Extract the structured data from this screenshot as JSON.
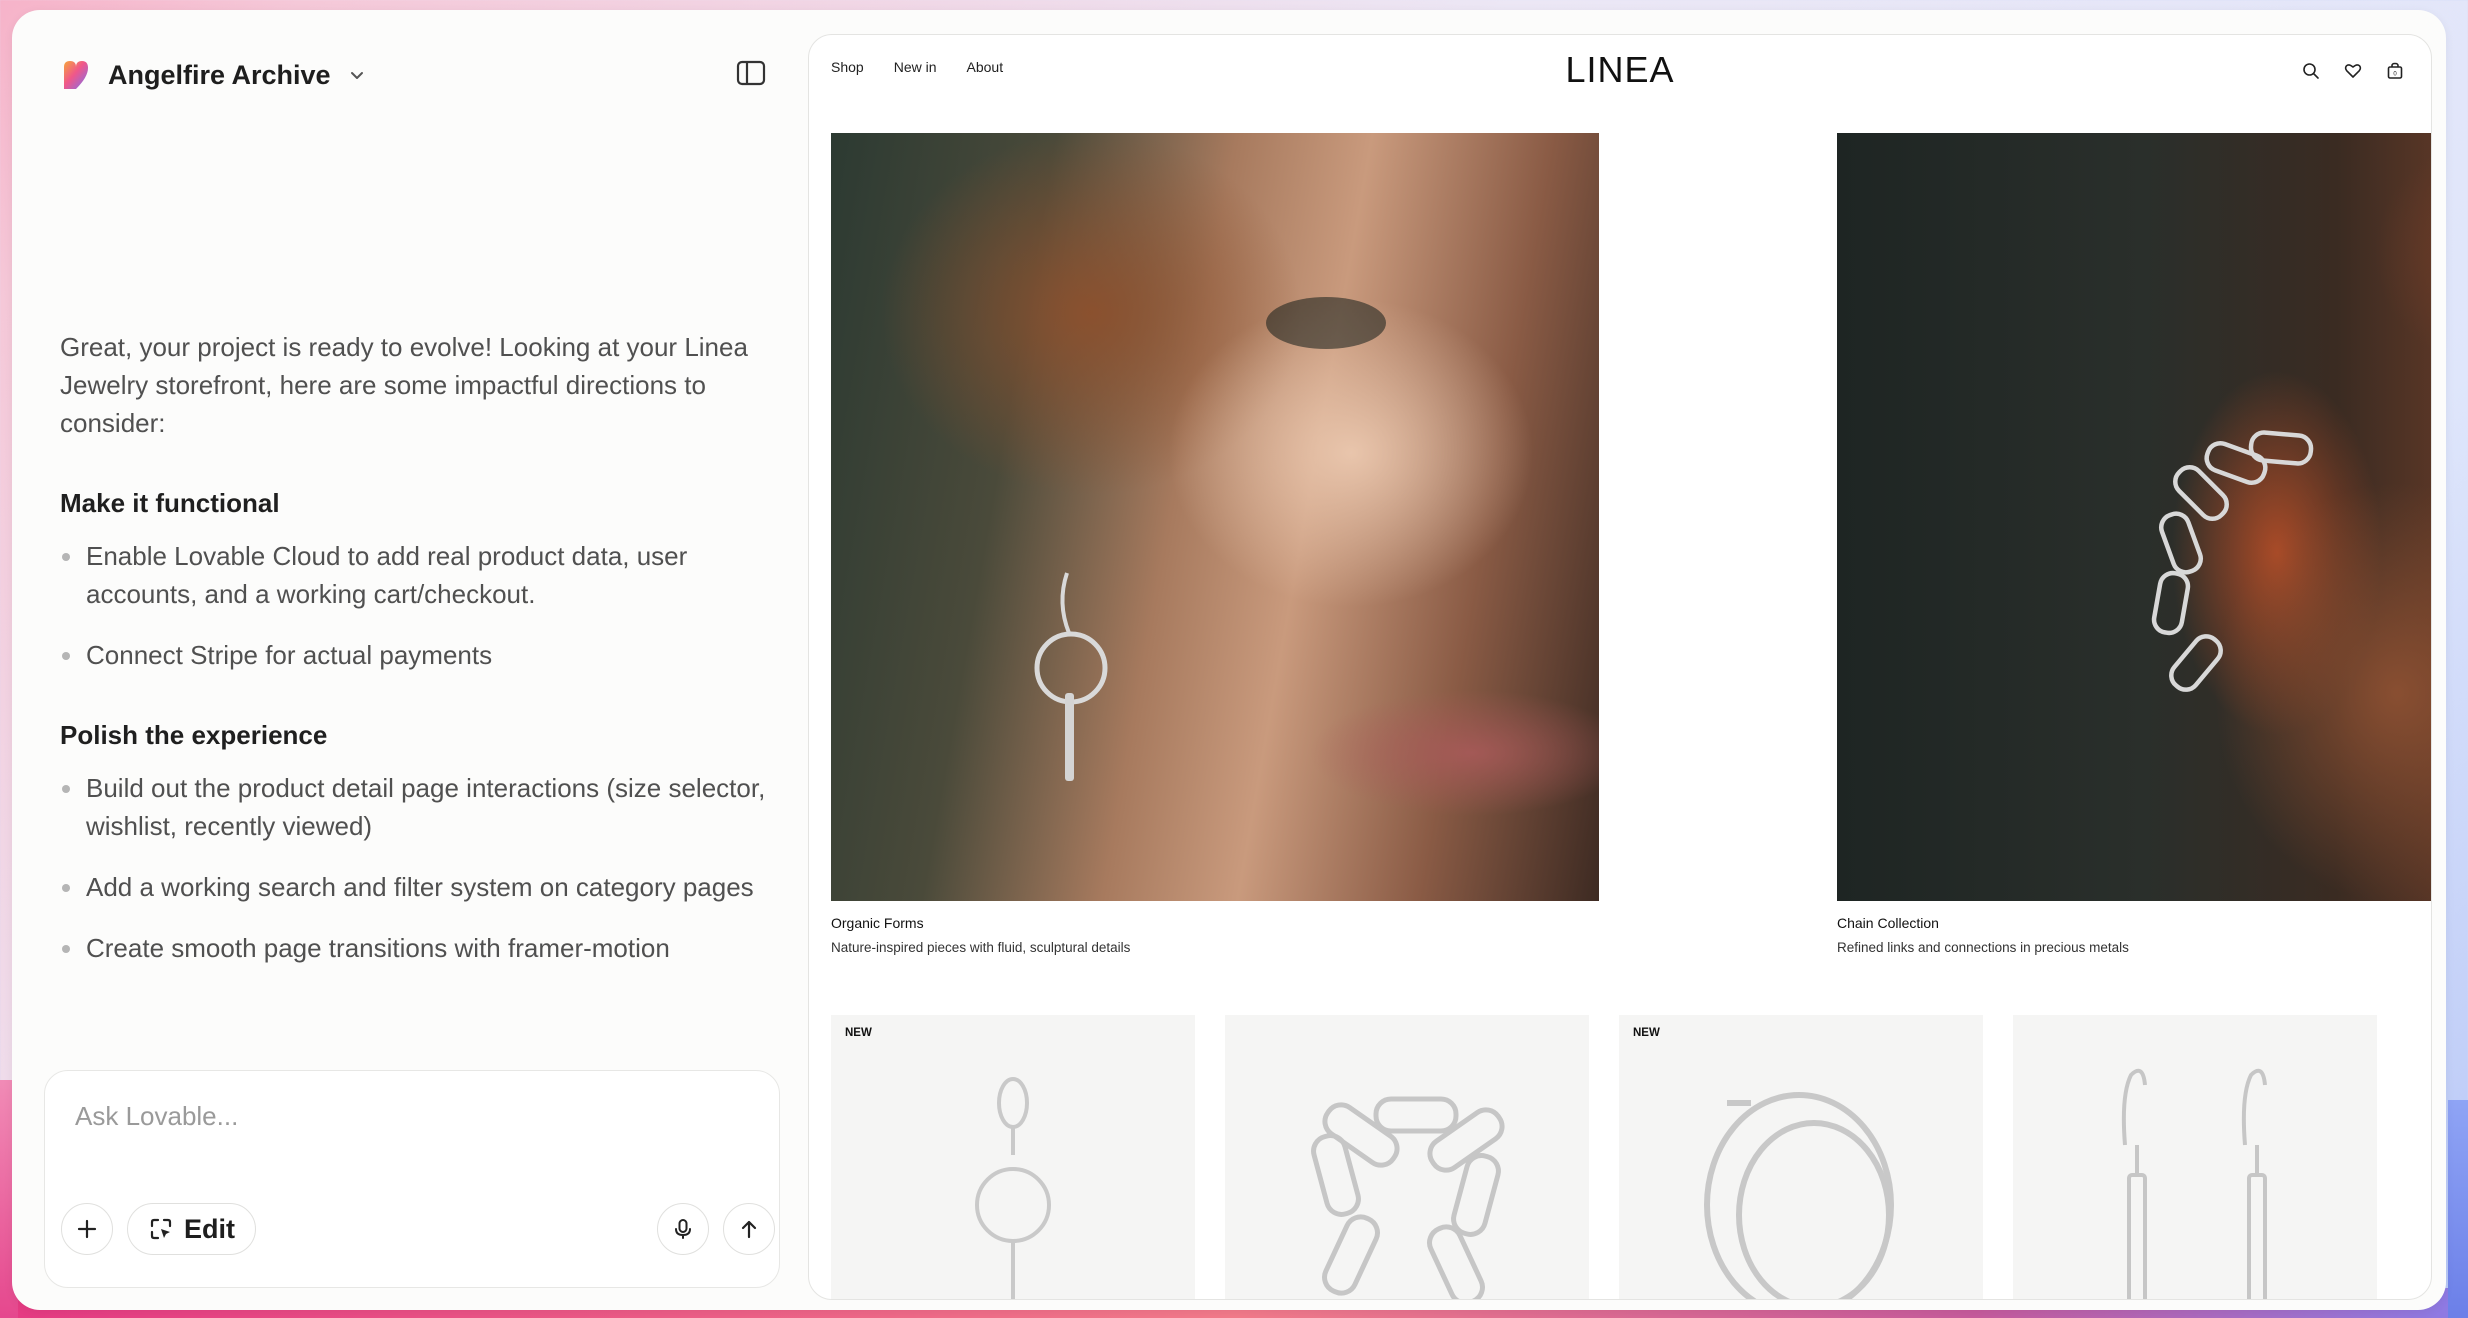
{
  "project": {
    "name": "Angelfire Archive"
  },
  "chat": {
    "intro": "Great, your project is ready to evolve! Looking at your Linea Jewelry storefront, here are some impactful directions to consider:",
    "sections": [
      {
        "heading": "Make it functional",
        "items": [
          "Enable Lovable Cloud to add real product data, user accounts, and a working cart/checkout.",
          "Connect Stripe for actual payments"
        ]
      },
      {
        "heading": "Polish the experience",
        "items": [
          "Build out the product detail page interactions (size selector, wishlist, recently viewed)",
          "Add a working search and filter system on category pages",
          "Create smooth page transitions with framer-motion"
        ]
      }
    ]
  },
  "composer": {
    "placeholder": "Ask Lovable...",
    "edit_label": "Edit"
  },
  "preview": {
    "nav": [
      "Shop",
      "New in",
      "About"
    ],
    "logo": "LINEA",
    "icons": [
      "search-icon",
      "heart-icon",
      "bag-icon"
    ],
    "heroes": [
      {
        "title": "Organic Forms",
        "subtitle": "Nature-inspired pieces with fluid, sculptural details"
      },
      {
        "title": "Chain Collection",
        "subtitle": "Refined links and connections in precious metals"
      }
    ],
    "products": [
      {
        "badge": "NEW",
        "kind": "circle-drop-earring"
      },
      {
        "badge": "",
        "kind": "chain-bracelet"
      },
      {
        "badge": "NEW",
        "kind": "hoop-earrings"
      },
      {
        "badge": "",
        "kind": "bar-drop-earrings"
      }
    ]
  },
  "colors": {
    "accent_gradient_start": "#f0578a",
    "accent_gradient_end": "#8c7be6",
    "card_bg": "#f5f5f4"
  }
}
